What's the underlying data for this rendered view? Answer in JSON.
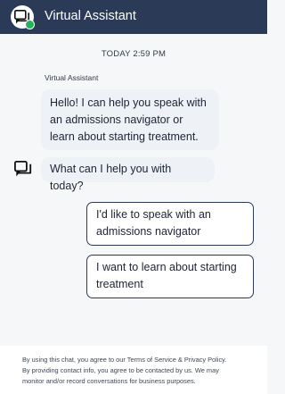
{
  "header": {
    "title": "Virtual Assistant",
    "status": "online",
    "icon": "chat-bubbles-icon"
  },
  "chat": {
    "timestamp": "TODAY 2:59 PM",
    "sender": "Virtual Assistant",
    "messages": [
      "Hello! I can help you speak with an admissions navigator or learn about starting treatment.",
      "What can I help you with today?"
    ],
    "options": [
      "I'd like to speak with an admissions navigator",
      "I want to learn about starting treatment"
    ]
  },
  "footer": {
    "lines": [
      "By using this chat, you agree to our Terms of Service & Privacy Policy.",
      "By providing contact info, you agree to be contacted by us. We may",
      "monitor and/or record conversations for business purposes."
    ]
  },
  "colors": {
    "header_bg": "#2b3a57",
    "online": "#22b35b",
    "bot_bubble": "#eef1f5",
    "page_bg": "#f6f7f9"
  }
}
